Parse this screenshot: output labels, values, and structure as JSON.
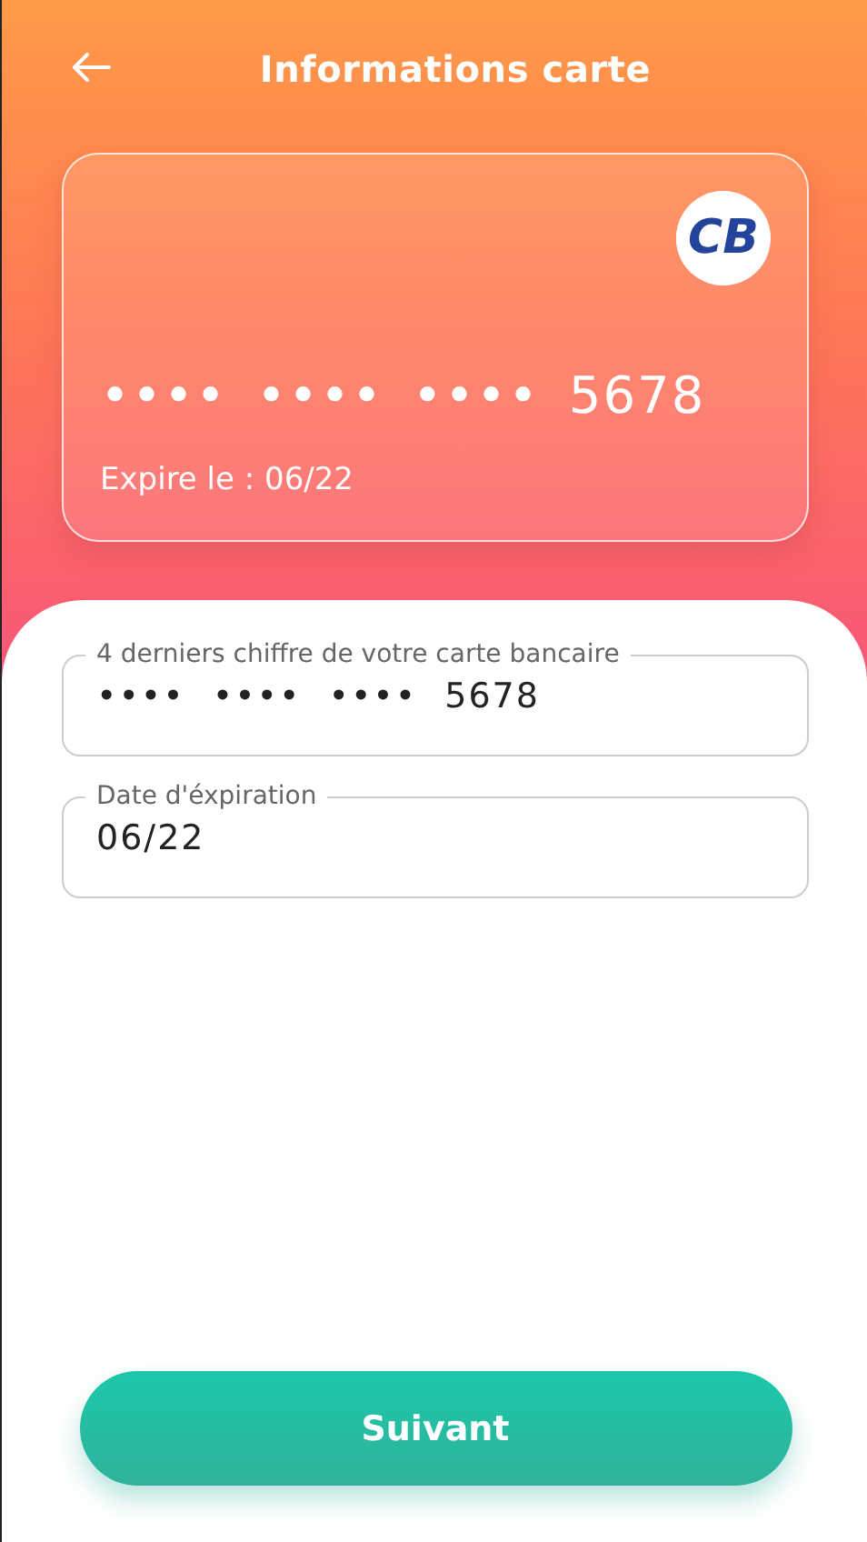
{
  "header": {
    "title": "Informations carte"
  },
  "card": {
    "brand": "CB",
    "number": "•••• •••• •••• 5678",
    "expiry": "Expire le : 06/22"
  },
  "fields": [
    {
      "label": "4 derniers chiffre de votre carte bancaire",
      "value": "•••• •••• •••• 5678"
    },
    {
      "label": "Date d'éxpiration",
      "value": "06/22"
    }
  ],
  "button": {
    "label": "Suivant"
  }
}
